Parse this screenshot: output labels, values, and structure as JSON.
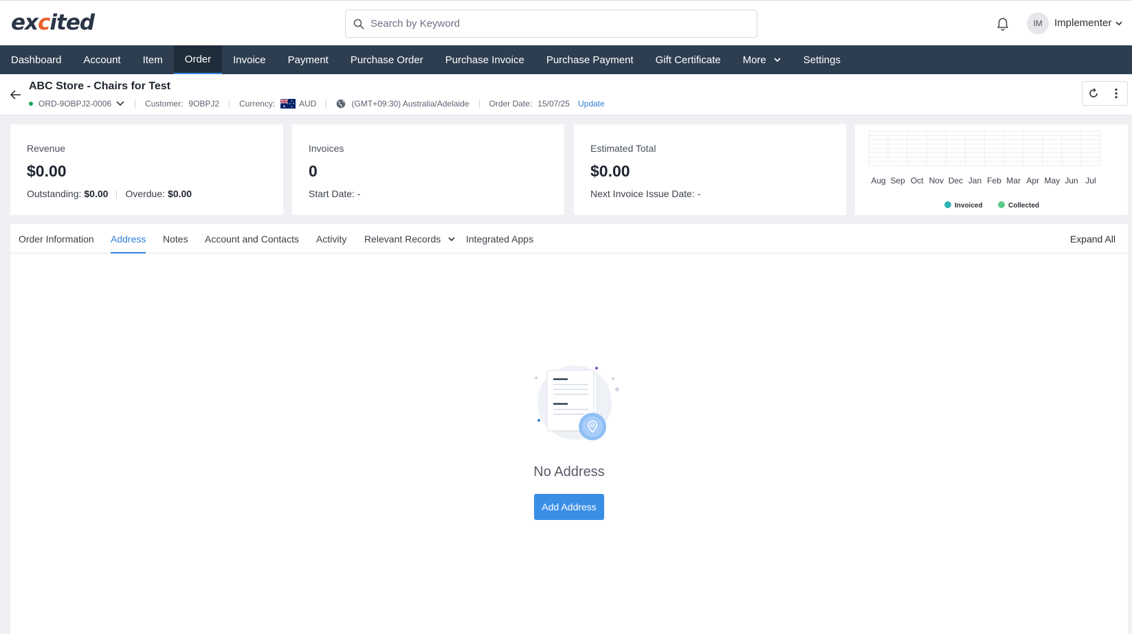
{
  "header": {
    "logo_left": "ex",
    "logo_accent": "c",
    "logo_right": "ited",
    "search_placeholder": "Search by Keyword",
    "user_initials": "IM",
    "user_name": "Implementer",
    "icons": {
      "search": "search-icon",
      "notifications": "bell-icon",
      "user_menu": "chevron-down-icon"
    }
  },
  "nav": {
    "items": [
      {
        "label": "Dashboard"
      },
      {
        "label": "Account"
      },
      {
        "label": "Item"
      },
      {
        "label": "Order",
        "active": true
      },
      {
        "label": "Invoice"
      },
      {
        "label": "Payment"
      },
      {
        "label": "Purchase Order"
      },
      {
        "label": "Purchase Invoice"
      },
      {
        "label": "Purchase Payment"
      },
      {
        "label": "Gift Certificate"
      },
      {
        "label": "More",
        "dropdown": true
      },
      {
        "label": "Settings"
      }
    ]
  },
  "record": {
    "title": "ABC Store - Chairs for Test",
    "order_number": "ORD-9OBPJ2-0006",
    "status_color": "#1ca35b",
    "customer_label": "Customer:",
    "customer_value": "9OBPJ2",
    "currency_label": "Currency:",
    "currency_value": "AUD",
    "timezone": "(GMT+09:30) Australia/Adelaide",
    "order_date_label": "Order Date:",
    "order_date_value": "15/07/25",
    "update_link": "Update"
  },
  "cards": {
    "revenue": {
      "label": "Revenue",
      "value": "$0.00",
      "outstanding_label": "Outstanding:",
      "outstanding_value": "$0.00",
      "overdue_label": "Overdue:",
      "overdue_value": "$0.00"
    },
    "invoices": {
      "label": "Invoices",
      "value": "0",
      "start_date_label": "Start Date:",
      "start_date_value": "-"
    },
    "estimated": {
      "label": "Estimated Total",
      "value": "$0.00",
      "next_issue_label": "Next Invoice Issue Date:",
      "next_issue_value": "-"
    }
  },
  "chart_data": {
    "type": "bar",
    "categories": [
      "Aug",
      "Sep",
      "Oct",
      "Nov",
      "Dec",
      "Jan",
      "Feb",
      "Mar",
      "Apr",
      "May",
      "Jun",
      "Jul"
    ],
    "series": [
      {
        "name": "Invoiced",
        "color": "#2bb5b0",
        "values": [
          0,
          0,
          0,
          0,
          0,
          0,
          0,
          0,
          0,
          0,
          0,
          0
        ]
      },
      {
        "name": "Collected",
        "color": "#5cc98a",
        "values": [
          0,
          0,
          0,
          0,
          0,
          0,
          0,
          0,
          0,
          0,
          0,
          0
        ]
      }
    ],
    "grid": true,
    "legend": "bottom"
  },
  "tabs": {
    "items": [
      {
        "label": "Order Information"
      },
      {
        "label": "Address",
        "active": true
      },
      {
        "label": "Notes"
      },
      {
        "label": "Account and Contacts"
      },
      {
        "label": "Activity"
      },
      {
        "label": "Relevant Records",
        "dropdown": true
      },
      {
        "label": "Integrated Apps"
      }
    ],
    "expand_all": "Expand All"
  },
  "empty_state": {
    "title": "No Address",
    "button": "Add Address",
    "icon": "map-pin-icon"
  },
  "colors": {
    "nav_bg": "#2d3e50",
    "accent": "#3a8ee6",
    "link": "#2f7fd8"
  }
}
